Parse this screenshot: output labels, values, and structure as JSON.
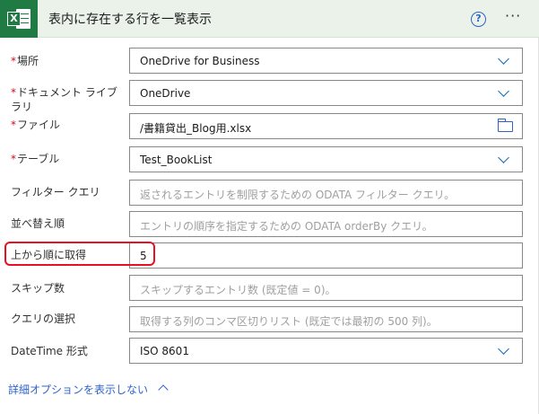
{
  "header": {
    "title": "表内に存在する行を一覧表示",
    "help_symbol": "?",
    "more_symbol": "···",
    "logo_letter": "X"
  },
  "fields": {
    "location": {
      "label": "場所",
      "required": "*",
      "value": "OneDrive for Business"
    },
    "library": {
      "label_line1": "ドキュメント ライブ",
      "label_line2": "ラリ",
      "required": "*",
      "value": "OneDrive"
    },
    "file": {
      "label": "ファイル",
      "required": "*",
      "value": "/書籍貸出_Blog用.xlsx"
    },
    "table": {
      "label": "テーブル",
      "required": "*",
      "value": "Test_BookList"
    },
    "filter": {
      "label": "フィルター クエリ",
      "placeholder": "返されるエントリを制限するための ODATA フィルター クエリ。"
    },
    "orderby": {
      "label": "並べ替え順",
      "placeholder": "エントリの順序を指定するための ODATA orderBy クエリ。"
    },
    "top": {
      "label": "上から順に取得",
      "value": "5"
    },
    "skip": {
      "label": "スキップ数",
      "placeholder": "スキップするエントリ数 (既定値 = 0)。"
    },
    "select": {
      "label": "クエリの選択",
      "placeholder": "取得する列のコンマ区切りリスト (既定では最初の 500 列)。"
    },
    "datetime": {
      "label": "DateTime 形式",
      "value": "ISO 8601"
    }
  },
  "advanced_link": "詳細オプションを表示しない",
  "colors": {
    "accent": "#2f63c9",
    "excel_green": "#1f7a44",
    "required": "#c50f1f",
    "highlight": "#e81123"
  }
}
